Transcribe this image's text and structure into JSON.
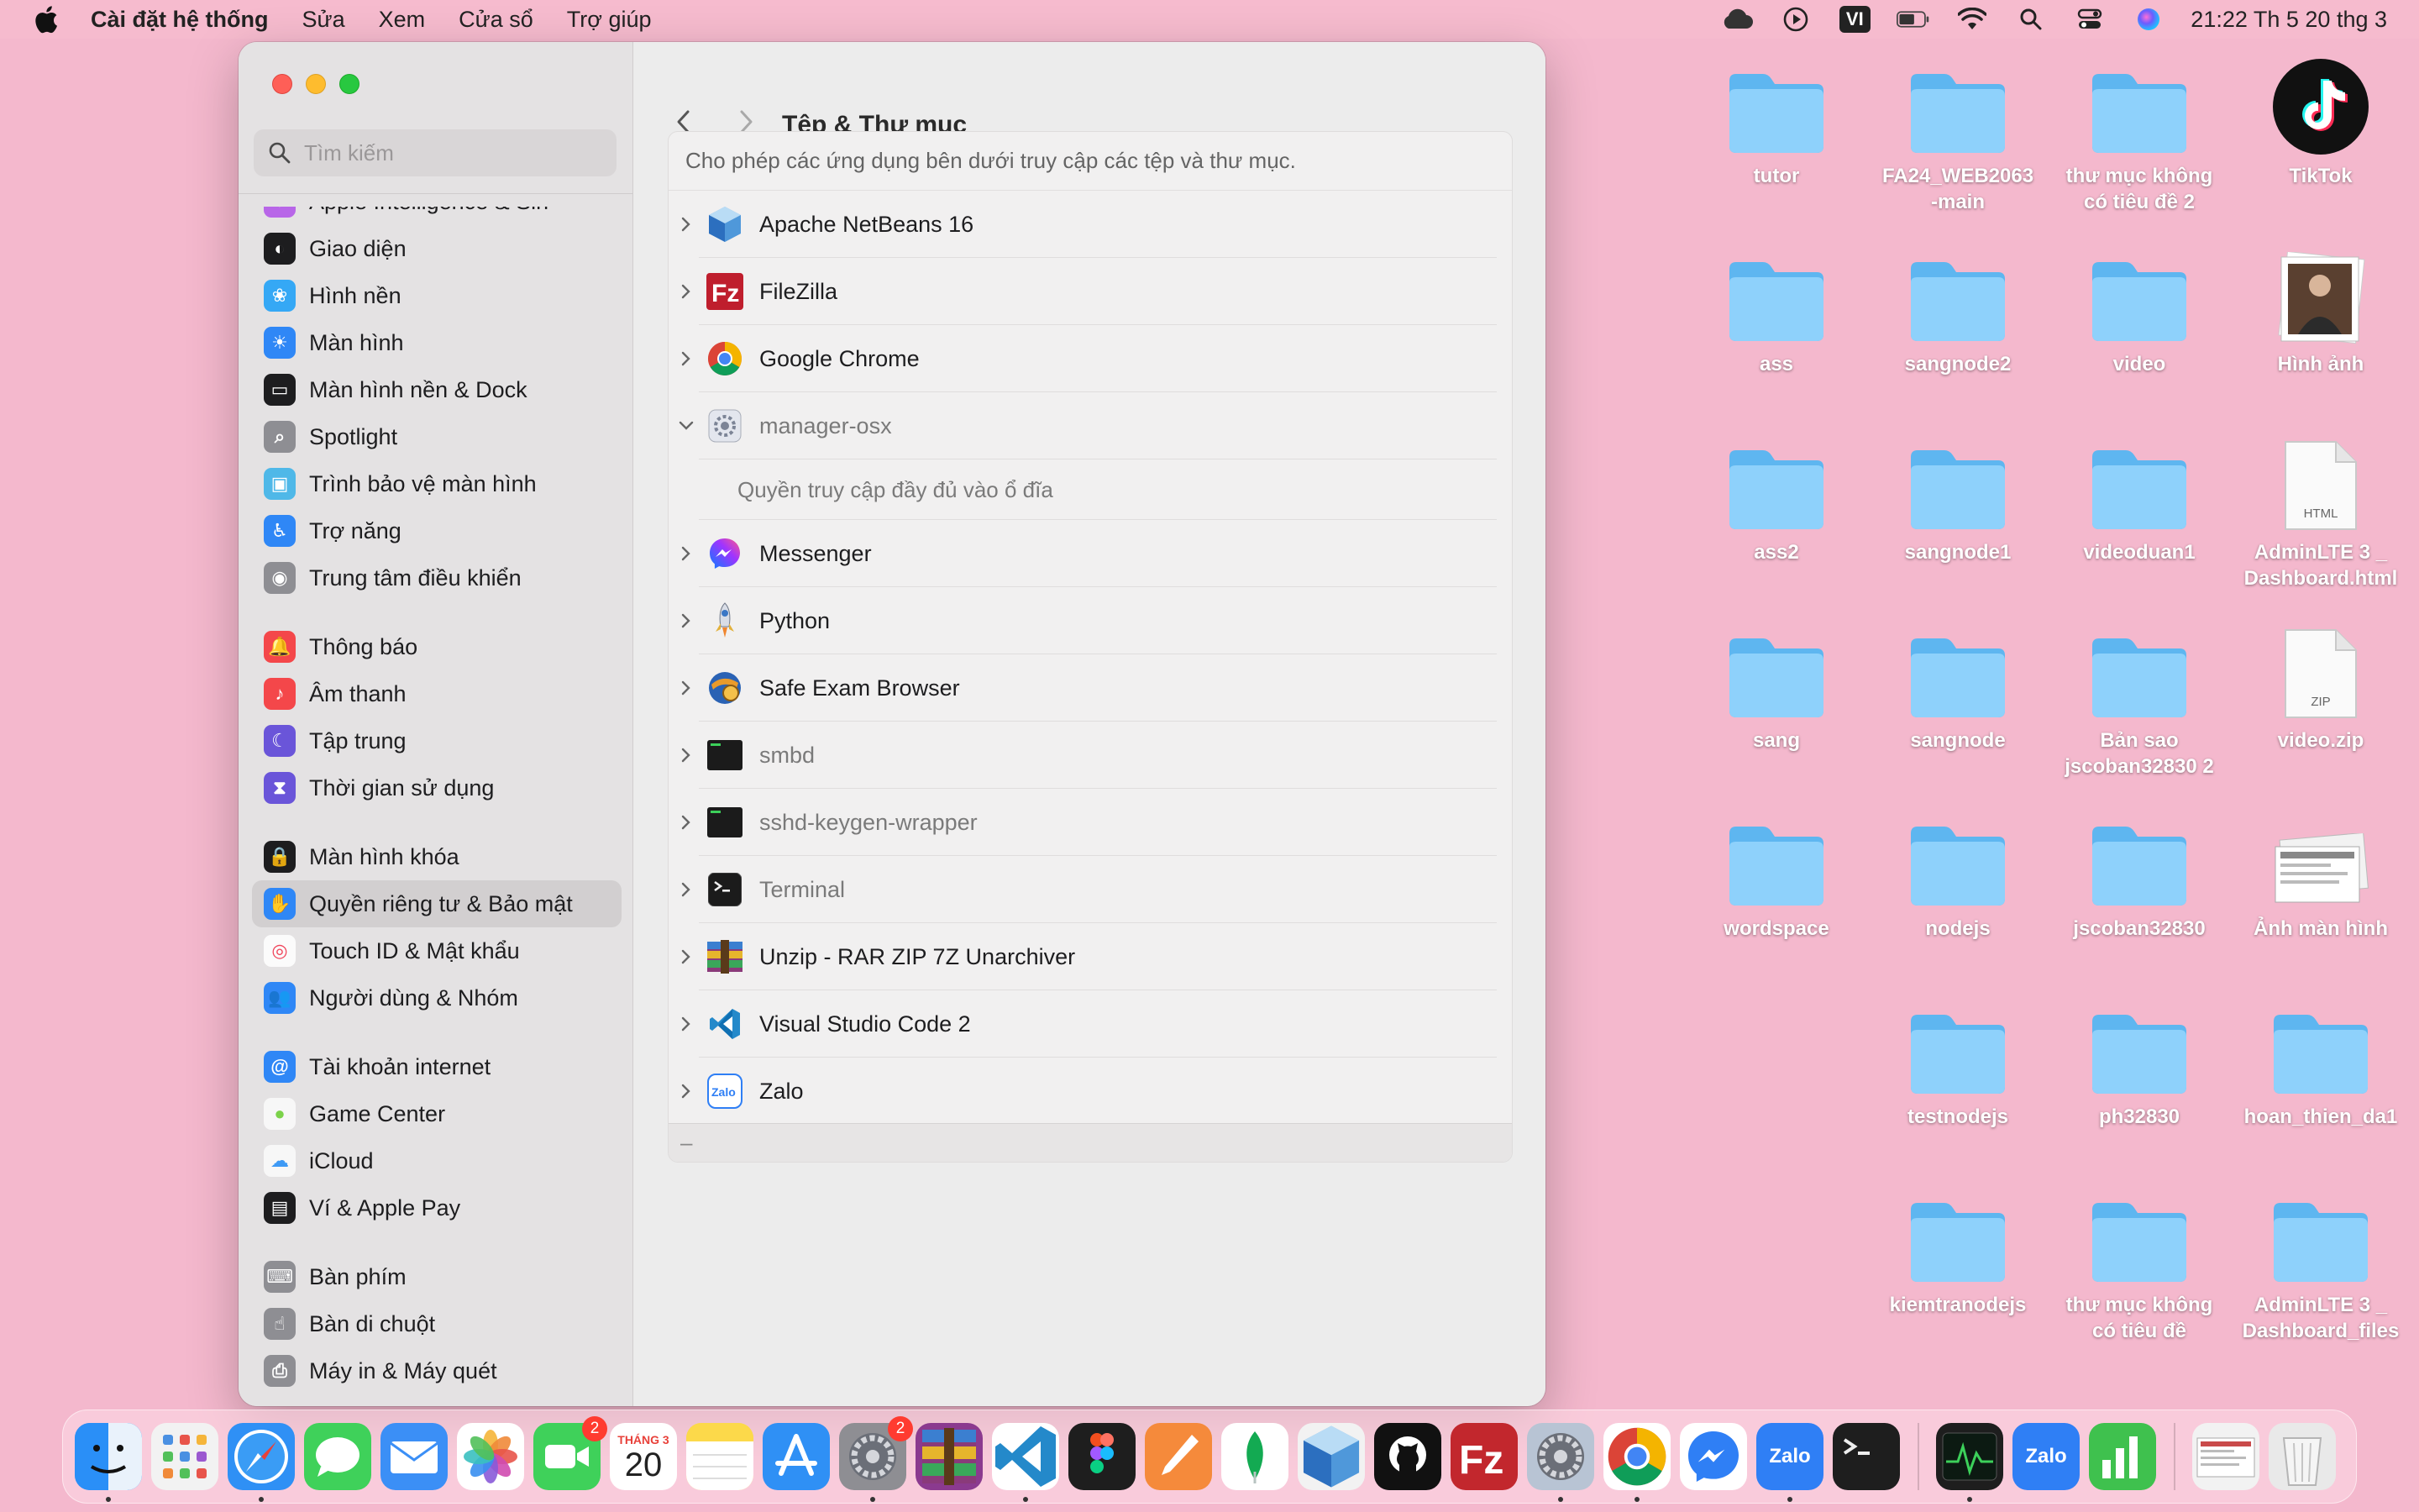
{
  "menubar": {
    "app_name": "Cài đặt hệ thống",
    "items": [
      "Sửa",
      "Xem",
      "Cửa sổ",
      "Trợ giúp"
    ],
    "input_lang": "VI",
    "clock": "21:22 Th 5 20 thg 3"
  },
  "window": {
    "search_placeholder": "Tìm kiếm",
    "title": "Tệp & Thư mục",
    "description": "Cho phép các ứng dụng bên dưới truy cập các tệp và thư mục.",
    "footer_symbol": "–"
  },
  "sidebar": {
    "items": [
      {
        "label": "Apple Intelligence & Siri",
        "icon": "siri-icon",
        "color": "#b866e8"
      },
      {
        "label": "Giao diện",
        "icon": "appearance-icon",
        "color": "#1d1d1f"
      },
      {
        "label": "Hình nền",
        "icon": "wallpaper-icon",
        "color": "#35a8f5"
      },
      {
        "label": "Màn hình",
        "icon": "display-icon",
        "color": "#2f87f6"
      },
      {
        "label": "Màn hình nền & Dock",
        "icon": "dock-icon",
        "color": "#1d1d1f"
      },
      {
        "label": "Spotlight",
        "icon": "spotlight-icon",
        "color": "#8e8e93"
      },
      {
        "label": "Trình bảo vệ màn hình",
        "icon": "screensaver-icon",
        "color": "#4fb8e8"
      },
      {
        "label": "Trợ năng",
        "icon": "accessibility-icon",
        "color": "#2f87f6"
      },
      {
        "label": "Trung tâm điều khiển",
        "icon": "control-center-icon",
        "color": "#8e8e93"
      },
      {
        "label": "Thông báo",
        "icon": "notifications-icon",
        "color": "#f4474a"
      },
      {
        "label": "Âm thanh",
        "icon": "sound-icon",
        "color": "#f4474a"
      },
      {
        "label": "Tập trung",
        "icon": "focus-icon",
        "color": "#6a55d9"
      },
      {
        "label": "Thời gian sử dụng",
        "icon": "screen-time-icon",
        "color": "#6a55d9"
      },
      {
        "label": "Màn hình khóa",
        "icon": "lock-icon",
        "color": "#1d1d1f"
      },
      {
        "label": "Quyền riêng tư & Bảo mật",
        "icon": "privacy-hand-icon",
        "color": "#2f87f6"
      },
      {
        "label": "Touch ID & Mật khẩu",
        "icon": "touch-id-icon",
        "color": "#fbfbfb"
      },
      {
        "label": "Người dùng & Nhóm",
        "icon": "users-icon",
        "color": "#2f87f6"
      },
      {
        "label": "Tài khoản internet",
        "icon": "at-icon",
        "color": "#2f87f6"
      },
      {
        "label": "Game Center",
        "icon": "game-center-icon",
        "color": "#f7f7f7"
      },
      {
        "label": "iCloud",
        "icon": "icloud-icon",
        "color": "#f7f7f7"
      },
      {
        "label": "Ví & Apple Pay",
        "icon": "wallet-icon",
        "color": "#1d1d1f"
      },
      {
        "label": "Bàn phím",
        "icon": "keyboard-icon",
        "color": "#8e8e93"
      },
      {
        "label": "Bàn di chuột",
        "icon": "trackpad-icon",
        "color": "#8e8e93"
      },
      {
        "label": "Máy in & Máy quét",
        "icon": "printer-icon",
        "color": "#8e8e93"
      }
    ]
  },
  "apps": [
    {
      "name": "Apache NetBeans 16",
      "icon": "netbeans-icon",
      "expanded": false,
      "dim": false
    },
    {
      "name": "FileZilla",
      "icon": "filezilla-icon",
      "expanded": false,
      "dim": false
    },
    {
      "name": "Google Chrome",
      "icon": "chrome-icon",
      "expanded": false,
      "dim": false
    },
    {
      "name": "manager-osx",
      "icon": "gear-doc-icon",
      "expanded": true,
      "dim": true,
      "sub": "Quyền truy cập đầy đủ vào ổ đĩa"
    },
    {
      "name": "Messenger",
      "icon": "messenger-icon",
      "expanded": false,
      "dim": false
    },
    {
      "name": "Python",
      "icon": "python-rocket-icon",
      "expanded": false,
      "dim": false
    },
    {
      "name": "Safe Exam Browser",
      "icon": "safe-exam-icon",
      "expanded": false,
      "dim": false
    },
    {
      "name": "smbd",
      "icon": "exec-icon",
      "expanded": false,
      "dim": true
    },
    {
      "name": "sshd-keygen-wrapper",
      "icon": "exec-icon",
      "expanded": false,
      "dim": true
    },
    {
      "name": "Terminal",
      "icon": "terminal-icon",
      "expanded": false,
      "dim": true
    },
    {
      "name": "Unzip - RAR ZIP 7Z Unarchiver",
      "icon": "unarchiver-icon",
      "expanded": false,
      "dim": false
    },
    {
      "name": "Visual Studio Code 2",
      "icon": "vscode-icon",
      "expanded": false,
      "dim": false
    },
    {
      "name": "Zalo",
      "icon": "zalo-icon",
      "expanded": false,
      "dim": false
    }
  ],
  "desktop": [
    {
      "label": "tutor",
      "type": "folder"
    },
    {
      "label": "FA24_WEB2063\n-main",
      "type": "folder"
    },
    {
      "label": "thư mục không\ncó tiêu đề 2",
      "type": "folder"
    },
    {
      "label": "TikTok",
      "type": "tiktok"
    },
    {
      "label": "ass",
      "type": "folder"
    },
    {
      "label": "sangnode2",
      "type": "folder"
    },
    {
      "label": "video",
      "type": "folder"
    },
    {
      "label": "Hình ảnh",
      "type": "photo"
    },
    {
      "label": "ass2",
      "type": "folder"
    },
    {
      "label": "sangnode1",
      "type": "folder"
    },
    {
      "label": "videoduan1",
      "type": "folder"
    },
    {
      "label": "AdminLTE 3 _\nDashboard.html",
      "type": "html",
      "doc_tag": "HTML"
    },
    {
      "label": "sang",
      "type": "folder"
    },
    {
      "label": "sangnode",
      "type": "folder"
    },
    {
      "label": "Bản sao\njscoban32830 2",
      "type": "folder"
    },
    {
      "label": "video.zip",
      "type": "zip",
      "doc_tag": "ZIP"
    },
    {
      "label": "wordspace",
      "type": "folder"
    },
    {
      "label": "nodejs",
      "type": "folder"
    },
    {
      "label": "jscoban32830",
      "type": "folder"
    },
    {
      "label": "Ảnh màn hình",
      "type": "screenshot"
    },
    {
      "label": "testnodejs",
      "type": "folder"
    },
    {
      "label": "ph32830",
      "type": "folder"
    },
    {
      "label": "hoan_thien_da1",
      "type": "folder"
    },
    {
      "label": "kiemtranodejs",
      "type": "folder"
    },
    {
      "label": "thư mục không\ncó tiêu đề",
      "type": "folder"
    },
    {
      "label": "AdminLTE 3 _\nDashboard_files",
      "type": "folder"
    }
  ],
  "dock": {
    "calendar": {
      "month": "THÁNG 3",
      "day": "20"
    },
    "apps": [
      {
        "name": "finder-icon",
        "color": "#2a8ff7",
        "dot": true
      },
      {
        "name": "launchpad-icon",
        "color": "#f2f2f2",
        "dot": false
      },
      {
        "name": "safari-icon",
        "color": "#2f90f5",
        "dot": true
      },
      {
        "name": "messages-icon",
        "color": "#3fd15a",
        "dot": false
      },
      {
        "name": "mail-icon",
        "color": "#3b8ff6",
        "dot": false
      },
      {
        "name": "photos-icon",
        "color": "#ffffff",
        "dot": false
      },
      {
        "name": "facetime-icon",
        "color": "#3fd15a",
        "badge": "2",
        "dot": false
      },
      {
        "name": "calendar-icon",
        "color": "#ffffff",
        "dot": false
      },
      {
        "name": "notes-icon",
        "color": "#fcd94a",
        "dot": false
      },
      {
        "name": "app-store-icon",
        "color": "#2f90f5",
        "dot": false
      },
      {
        "name": "system-settings-icon",
        "color": "#8e8e93",
        "badge": "2",
        "dot": true
      },
      {
        "name": "winrar-icon",
        "color": "#8b3a8f",
        "dot": false
      },
      {
        "name": "vscode-icon",
        "color": "#ffffff",
        "dot": true
      },
      {
        "name": "figma-icon",
        "color": "#1e1e1e",
        "dot": false
      },
      {
        "name": "pages-icon",
        "color": "#f58a3b",
        "dot": false
      },
      {
        "name": "mongodb-icon",
        "color": "#ffffff",
        "dot": false
      },
      {
        "name": "netbeans-icon",
        "color": "#f2f2f2",
        "dot": false
      },
      {
        "name": "github-icon",
        "color": "#111111",
        "dot": false
      },
      {
        "name": "filezilla-icon",
        "color": "#c2272d",
        "dot": false
      },
      {
        "name": "system-preferences-icon",
        "color": "#b8c4d4",
        "dot": true
      },
      {
        "name": "chrome-icon",
        "color": "#ffffff",
        "dot": true
      },
      {
        "name": "messenger-icon",
        "color": "#ffffff",
        "dot": false
      },
      {
        "name": "zalo-icon",
        "color": "#2f7ff5",
        "label": "Zalo",
        "dot": true
      },
      {
        "name": "terminal-icon",
        "color": "#1e1e1e",
        "dot": false
      },
      {
        "name": "activity-monitor-icon",
        "color": "#1e1e1e",
        "dot": true,
        "after_sep": true
      },
      {
        "name": "zalo-icon",
        "color": "#2f7ff5",
        "label": "Zalo",
        "dot": false
      },
      {
        "name": "numbers-icon",
        "color": "#3fc14e",
        "dot": false
      },
      {
        "name": "screenshot-doc-icon",
        "color": "#f2f2f2",
        "dot": false,
        "after_sep": true
      },
      {
        "name": "trash-icon",
        "color": "#e9e9e9",
        "dot": false
      }
    ]
  }
}
